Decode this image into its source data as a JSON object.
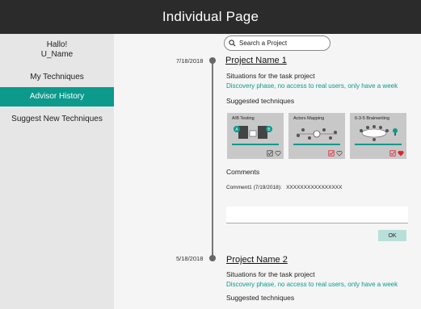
{
  "header": {
    "title": "Individual Page"
  },
  "sidebar": {
    "greeting": "Hallo!",
    "username": "U_Name",
    "items": [
      {
        "label": "My Techniques",
        "active": false
      },
      {
        "label": "Advisor History",
        "active": true
      },
      {
        "label": "Suggest New Techniques",
        "active": false
      }
    ]
  },
  "search": {
    "placeholder": "Search a Project"
  },
  "projects": [
    {
      "date": "7/18/2018",
      "name": "Project Name 1",
      "situations_label": "Situations for the task project",
      "situations_note": "Discovery phase, no access to real users, only have a week",
      "suggested_label": "Suggested techniques",
      "techniques": [
        {
          "name": "A/B Testing",
          "checked": false,
          "liked": false
        },
        {
          "name": "Actors Mapping",
          "checked": true,
          "liked": false
        },
        {
          "name": "6-3-5 Brainwriting",
          "checked": true,
          "liked": true
        }
      ],
      "comments_label": "Comments",
      "comments": [
        {
          "date": "(7/19/2018):",
          "text": "XXXXXXXXXXXXXXXX",
          "author": "Comment1"
        }
      ],
      "ok_label": "OK"
    },
    {
      "date": "5/18/2018",
      "name": "Project Name 2",
      "situations_label": "Situations for the task project",
      "situations_note": "Discovery phase, no access to real users, only have a week",
      "suggested_label": "Suggested techniques"
    }
  ],
  "colors": {
    "accent": "#0b9a8c",
    "header": "#2b2b2b",
    "sidebar": "#e6e6e6",
    "liked": "#e0202a"
  }
}
